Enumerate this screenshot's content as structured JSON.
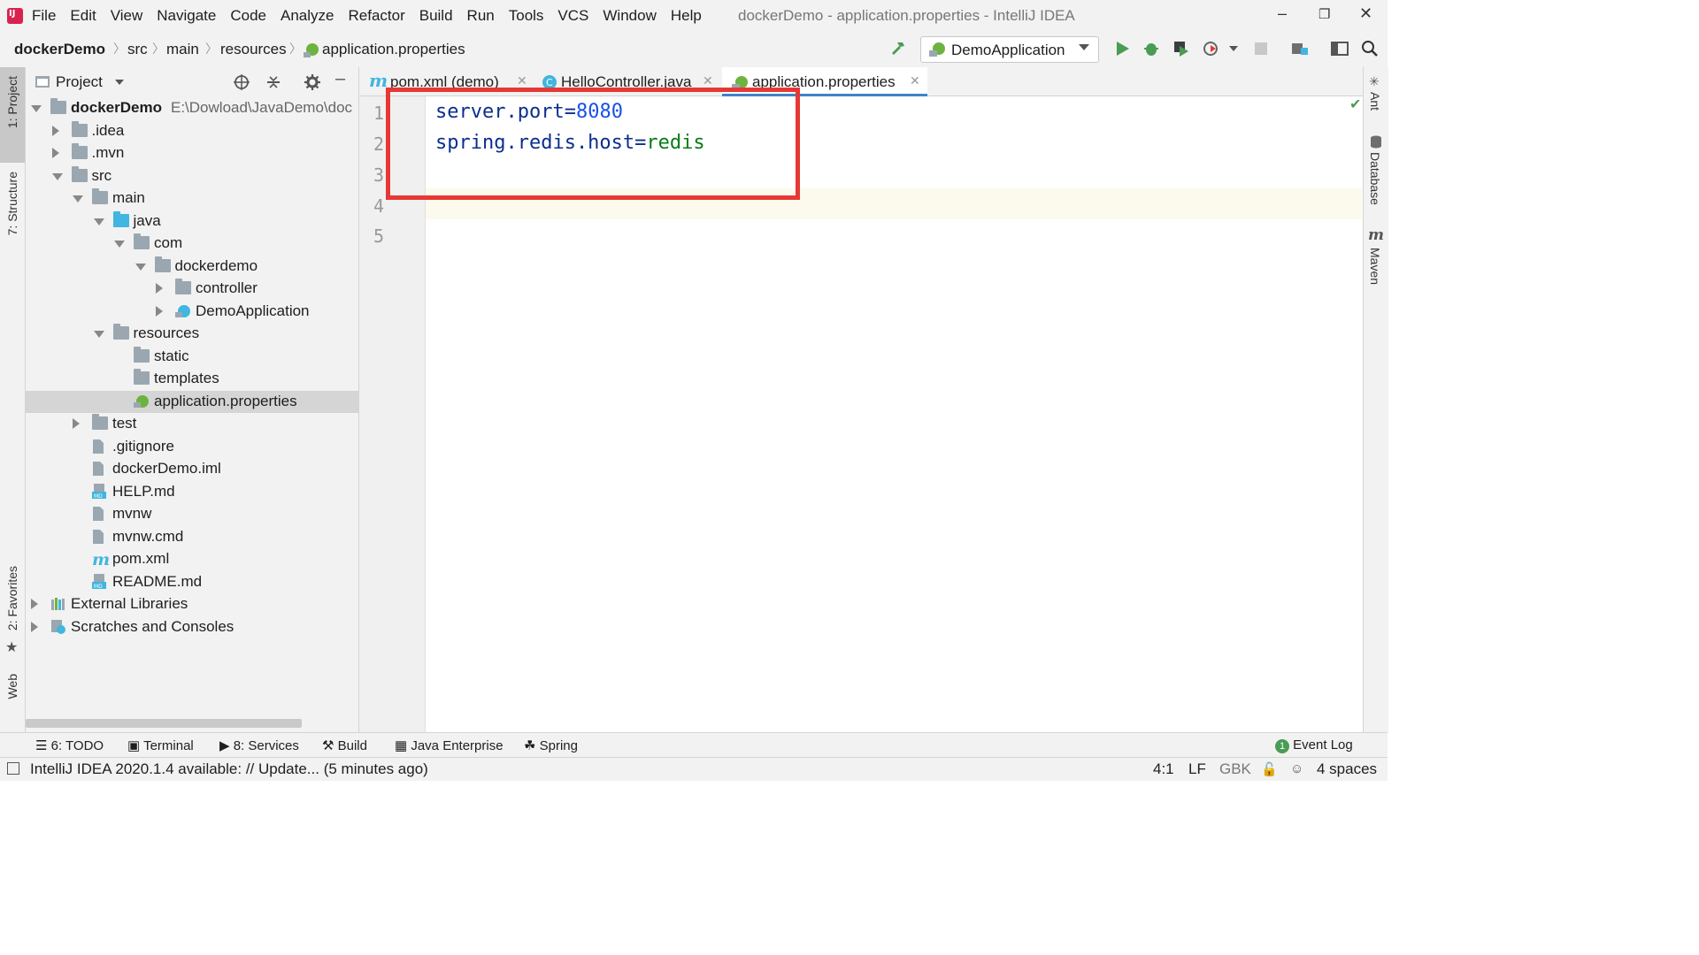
{
  "menu": [
    "File",
    "Edit",
    "View",
    "Navigate",
    "Code",
    "Analyze",
    "Refactor",
    "Build",
    "Run",
    "Tools",
    "VCS",
    "Window",
    "Help"
  ],
  "window_title": "dockerDemo - application.properties - IntelliJ IDEA",
  "breadcrumbs": [
    "dockerDemo",
    "src",
    "main",
    "resources",
    "application.properties"
  ],
  "run_config": "DemoApplication",
  "left_tabs": {
    "project": "1: Project",
    "structure": "7: Structure",
    "favorites": "2: Favorites",
    "web": "Web"
  },
  "project_panel": {
    "title": "Project",
    "root_path": "E:\\Dowload\\JavaDemo\\doc"
  },
  "tree": [
    {
      "label": "dockerDemo",
      "kind": "module",
      "arrow": "expanded",
      "depth": 0
    },
    {
      "label": ".idea",
      "kind": "folder",
      "arrow": "collapsed",
      "depth": 1
    },
    {
      "label": ".mvn",
      "kind": "folder",
      "arrow": "collapsed",
      "depth": 1
    },
    {
      "label": "src",
      "kind": "folder",
      "arrow": "expanded",
      "depth": 1
    },
    {
      "label": "main",
      "kind": "folder",
      "arrow": "expanded",
      "depth": 2
    },
    {
      "label": "java",
      "kind": "folder-blue",
      "arrow": "expanded",
      "depth": 3
    },
    {
      "label": "com",
      "kind": "package",
      "arrow": "expanded",
      "depth": 4
    },
    {
      "label": "dockerdemo",
      "kind": "package",
      "arrow": "expanded",
      "depth": 5
    },
    {
      "label": "controller",
      "kind": "package",
      "arrow": "collapsed",
      "depth": 6
    },
    {
      "label": "DemoApplication",
      "kind": "spring-class",
      "arrow": "collapsed",
      "depth": 6
    },
    {
      "label": "resources",
      "kind": "resources",
      "arrow": "expanded",
      "depth": 3
    },
    {
      "label": "static",
      "kind": "folder",
      "arrow": "none",
      "depth": 4
    },
    {
      "label": "templates",
      "kind": "folder",
      "arrow": "none",
      "depth": 4
    },
    {
      "label": "application.properties",
      "kind": "spring-properties",
      "arrow": "none",
      "depth": 4,
      "selected": true
    },
    {
      "label": "test",
      "kind": "folder",
      "arrow": "collapsed",
      "depth": 2
    },
    {
      "label": ".gitignore",
      "kind": "file",
      "arrow": "none",
      "depth": 2
    },
    {
      "label": "dockerDemo.iml",
      "kind": "file",
      "arrow": "none",
      "depth": 2
    },
    {
      "label": "HELP.md",
      "kind": "md-file",
      "arrow": "none",
      "depth": 2
    },
    {
      "label": "mvnw",
      "kind": "script-file",
      "arrow": "none",
      "depth": 2
    },
    {
      "label": "mvnw.cmd",
      "kind": "text-file",
      "arrow": "none",
      "depth": 2
    },
    {
      "label": "pom.xml",
      "kind": "maven-file",
      "arrow": "none",
      "depth": 2
    },
    {
      "label": "README.md",
      "kind": "md-file",
      "arrow": "none",
      "depth": 2
    },
    {
      "label": "External Libraries",
      "kind": "libraries",
      "arrow": "collapsed",
      "depth": 0
    },
    {
      "label": "Scratches and Consoles",
      "kind": "scratches",
      "arrow": "collapsed",
      "depth": 0
    }
  ],
  "editor_tabs": [
    {
      "label": "pom.xml (demo)",
      "icon": "maven",
      "active": false
    },
    {
      "label": "HelloController.java",
      "icon": "class",
      "active": false
    },
    {
      "label": "application.properties",
      "icon": "spring",
      "active": true
    }
  ],
  "line_numbers": [
    "1",
    "2",
    "3",
    "4",
    "5"
  ],
  "code": [
    {
      "key": "server.port",
      "eq": "=",
      "value": "8080",
      "value_type": "number"
    },
    {
      "key": "spring.redis.host",
      "eq": "=",
      "value": "redis",
      "value_type": "string"
    }
  ],
  "right_tabs": [
    "Ant",
    "Database",
    "Maven"
  ],
  "bottom_tools": [
    {
      "label": "6: TODO",
      "icon": "list-icon"
    },
    {
      "label": "Terminal",
      "icon": "terminal-icon"
    },
    {
      "label": "8: Services",
      "icon": "services-icon"
    },
    {
      "label": "Build",
      "icon": "hammer-icon"
    },
    {
      "label": "Java Enterprise",
      "icon": "enterprise-icon"
    },
    {
      "label": "Spring",
      "icon": "spring-icon"
    }
  ],
  "event_log": {
    "label": "Event Log",
    "count": "1"
  },
  "status": {
    "message": "IntelliJ IDEA 2020.1.4 available: // Update... (5 minutes ago)",
    "position": "4:1",
    "line_sep": "LF",
    "encoding": "GBK",
    "indent": "4 spaces"
  },
  "colors": {
    "accent": "#4083c9",
    "highlight_box": "#e53935",
    "run_green": "#499c54",
    "key": "#0b2e8f",
    "number": "#1750eb",
    "string": "#067d17"
  }
}
